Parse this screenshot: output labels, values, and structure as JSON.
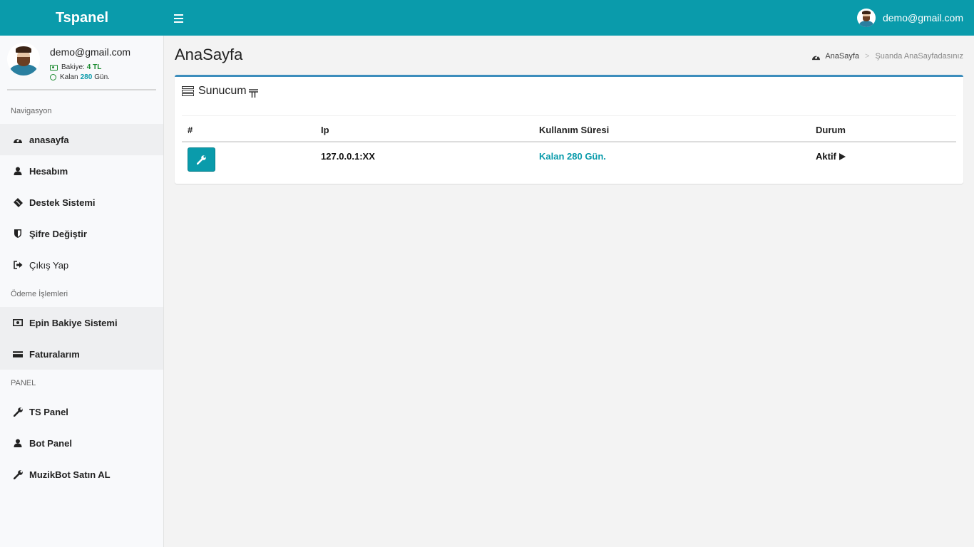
{
  "header": {
    "brand": "Tspanel",
    "user_email": "demo@gmail.com"
  },
  "sidebar": {
    "profile": {
      "email": "demo@gmail.com",
      "balance_label": "Bakiye:",
      "balance_value": "4 TL",
      "remaining_label": "Kalan",
      "remaining_value": "280",
      "remaining_unit": "Gün."
    },
    "sections": {
      "nav": "Navigasyon",
      "payment": "Ödeme İşlemleri",
      "panel": "PANEL"
    },
    "nav_items": [
      {
        "label": "anasayfa",
        "icon": "dashboard-icon"
      },
      {
        "label": "Hesabım",
        "icon": "user-icon"
      },
      {
        "label": "Destek Sistemi",
        "icon": "ticket-icon"
      },
      {
        "label": "Şifre Değiştir",
        "icon": "shield-icon"
      },
      {
        "label": "Çıkış Yap",
        "icon": "sign-out-icon"
      }
    ],
    "payment_items": [
      {
        "label": "Epin Bakiye Sistemi",
        "icon": "money-icon"
      },
      {
        "label": "Faturalarım",
        "icon": "credit-card-icon"
      }
    ],
    "panel_items": [
      {
        "label": "TS Panel",
        "icon": "wrench-icon"
      },
      {
        "label": "Bot Panel",
        "icon": "user-icon"
      },
      {
        "label": "MuzikBot Satın AL",
        "icon": "wrench-icon"
      }
    ]
  },
  "main": {
    "page_title": "AnaSayfa",
    "breadcrumb": {
      "home": "AnaSayfa",
      "current": "Şuanda AnaSayfadasınız"
    },
    "box": {
      "title": "Sunucum",
      "columns": [
        "#",
        "Ip",
        "Kullanım Süresi",
        "Durum"
      ],
      "rows": [
        {
          "ip": "127.0.0.1:XX",
          "usage": "Kalan 280 Gün.",
          "status": "Aktif"
        }
      ]
    }
  },
  "colors": {
    "accent": "#0a9bab",
    "box_border": "#3c8dbc",
    "balance_green": "#1a8a2e"
  }
}
